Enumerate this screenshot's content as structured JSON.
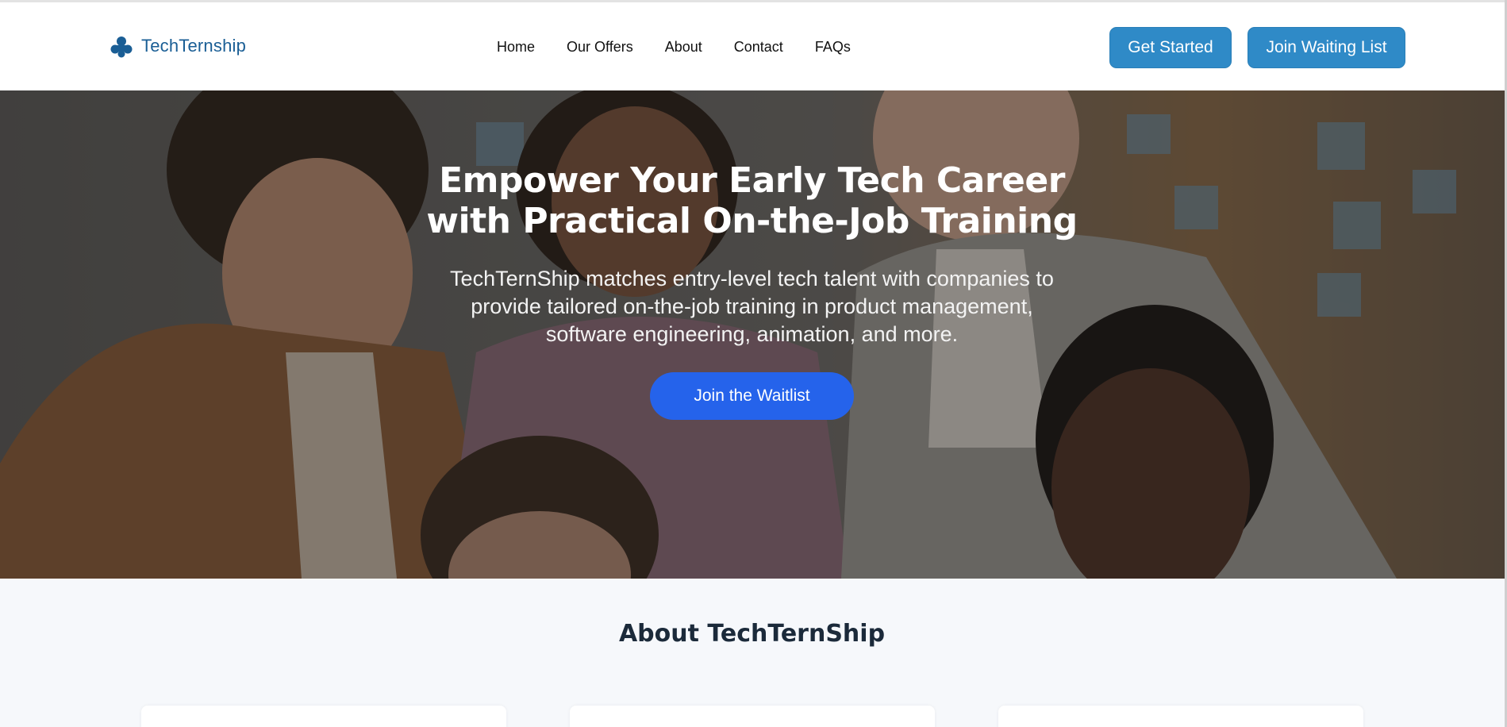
{
  "header": {
    "brand": "TechTernship",
    "nav": [
      "Home",
      "Our Offers",
      "About",
      "Contact",
      "FAQs"
    ],
    "get_started": "Get Started",
    "join_waiting_list": "Join Waiting List"
  },
  "hero": {
    "title_line1": "Empower Your Early Tech Career",
    "title_line2": "with Practical On-the-Job Training",
    "subtitle_line1": "TechTernShip matches entry-level tech talent with companies to",
    "subtitle_line2": "provide tailored on-the-job training in product management,",
    "subtitle_line3": "software engineering, animation, and more.",
    "cta": "Join the Waitlist"
  },
  "about": {
    "title": "About TechTernShip"
  },
  "colors": {
    "brand_blue": "#1a5e95",
    "header_button": "#2f8ac7",
    "cta_blue": "#2563eb",
    "about_bg": "#f6f8fb"
  },
  "icons": {
    "logo": "three-dot-network-logo"
  }
}
